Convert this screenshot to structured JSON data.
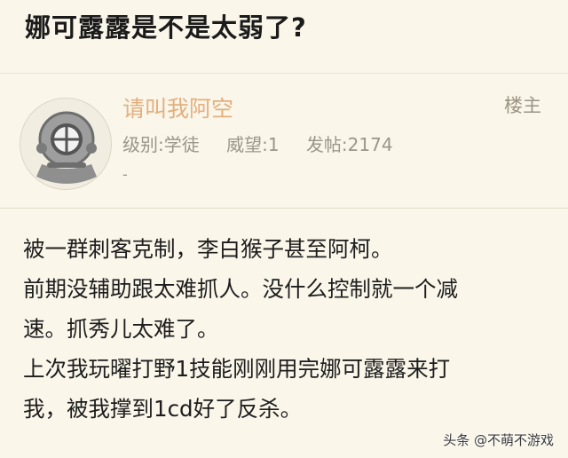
{
  "thread": {
    "title": "娜可露露是不是太弱了?"
  },
  "author": {
    "avatar_icon": "diving-helmet-icon",
    "name": "请叫我阿空",
    "owner_badge": "楼主",
    "level": "级别:学徒",
    "prestige": "威望:1",
    "posts": "发帖:2174",
    "dash": "-"
  },
  "post": {
    "lines": [
      "被一群刺客克制，李白猴子甚至阿柯。",
      "前期没辅助跟太难抓人。没什么控制就一个减",
      "速。抓秀儿太难了。",
      "上次我玩曜打野1技能刚刚用完娜可露露来打",
      "我，被我撑到1cd好了反杀。"
    ]
  },
  "watermark": "头条 @不萌不游戏",
  "colors": {
    "background": "#faf6ea",
    "username": "#e3b07e",
    "meta_text": "#9b9688"
  }
}
